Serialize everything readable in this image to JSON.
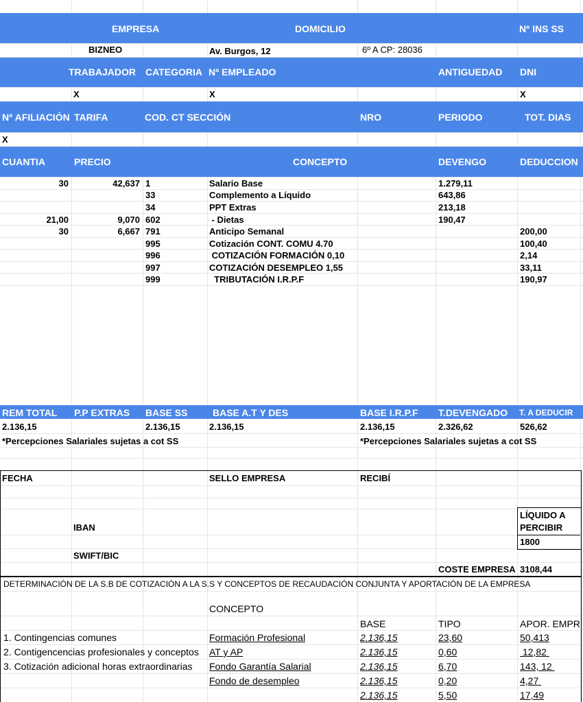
{
  "header1": {
    "empresa": "EMPRESA",
    "domicilio": "DOMICILIO",
    "ins_ss": "Nº INS SS"
  },
  "company": {
    "name": "BIZNEO",
    "address": "Av. Burgos, 12",
    "floor_cp": "6º A  CP: 28036"
  },
  "header2": {
    "trabajador": "TRABAJADOR",
    "categoria": "CATEGORIA",
    "empleado": "Nº EMPLEADO",
    "antiguedad": "ANTIGUEDAD",
    "dni": "DNI"
  },
  "row2": {
    "trabajador": "X",
    "empleado": "X",
    "dni": "X"
  },
  "header3": {
    "afiliacion": "Nº AFILIACIÓN",
    "tarifa": "TARIFA",
    "codct": "COD. CT SECCIÓN",
    "nro": "NRO",
    "periodo": "PERIODO",
    "totdias": "TOT. DIAS"
  },
  "row3": {
    "afiliacion": "X"
  },
  "header4": {
    "cuantia": "CUANTIA",
    "precio": "PRECIO",
    "concepto": "CONCEPTO",
    "devengo": "DEVENGO",
    "deduccion": "DEDUCCION"
  },
  "lines": [
    {
      "cuantia": "30",
      "precio": "42,637",
      "code": "1",
      "concepto": "Salario Base",
      "devengo": "1.279,11",
      "deduccion": ""
    },
    {
      "cuantia": "",
      "precio": "",
      "code": "33",
      "concepto": "Complemento a Líquido",
      "devengo": "643,86",
      "deduccion": ""
    },
    {
      "cuantia": "",
      "precio": "",
      "code": "34",
      "concepto": "PPT Extras",
      "devengo": "213,18",
      "deduccion": ""
    },
    {
      "cuantia": "21,00",
      "precio": "9,070",
      "code": "602",
      "concepto": " - Dietas",
      "devengo": "190,47",
      "deduccion": ""
    },
    {
      "cuantia": "30",
      "precio": "6,667",
      "code": "791",
      "concepto": "Anticipo Semanal",
      "devengo": "",
      "deduccion": "200,00"
    },
    {
      "cuantia": "",
      "precio": "",
      "code": "995",
      "concepto": "Cotización CONT. COMU 4.70",
      "devengo": "",
      "deduccion": "100,40"
    },
    {
      "cuantia": "",
      "precio": "",
      "code": "996",
      "concepto": " COTIZACIÓN FORMACIÓN 0,10",
      "devengo": "",
      "deduccion": "2,14"
    },
    {
      "cuantia": "",
      "precio": "",
      "code": "997",
      "concepto": "COTIZACIÓN DESEMPLEO 1,55",
      "devengo": "",
      "deduccion": "33,11"
    },
    {
      "cuantia": "",
      "precio": "",
      "code": "999",
      "concepto": "  TRIBUTACIÓN I.R.P.F",
      "devengo": "",
      "deduccion": "190,97"
    }
  ],
  "header5": {
    "rem_total": "REM TOTAL",
    "pp_extras": "P.P EXTRAS",
    "base_ss": "BASE SS",
    "base_at": "BASE A.T Y DES",
    "base_irpf": "BASE I.R.P.F",
    "t_devengado": "T.DEVENGADO",
    "t_deducir": "T. A DEDUCIR"
  },
  "totals": {
    "rem_total": "2.136,15",
    "base_ss": "2.136,15",
    "base_at": "2.136,15",
    "base_irpf": "2.136,15",
    "t_devengado": "2.326,62",
    "t_deducir": "526,62"
  },
  "notes": {
    "left": "*Percepciones Salariales sujetas a cot SS",
    "right": "*Percepciones Salariales sujetas a cot SS"
  },
  "signature": {
    "fecha": "FECHA",
    "sello": "SELLO EMPRESA",
    "recibi": "RECIBÍ",
    "iban": "IBAN",
    "swift": "SWIFT/BIC",
    "liquido_l1": "LÍQUIDO A",
    "liquido_l2": "PERCIBIR",
    "liquido_value": "1800",
    "coste_label": "COSTE EMPRESA",
    "coste_value": "3108,44"
  },
  "determination": {
    "title": "DETERMINACIÓN DE LA S.B DE COTIZACIÓN A LA S.S  Y CONCEPTOS DE RECAUDACIÓN CONJUNTA Y APORTACIÓN DE LA EMPRESA",
    "concepto": "CONCEPTO",
    "base": "BASE",
    "tipo": "TIPO",
    "apor": "APOR. EMPRESA",
    "rows": [
      {
        "left": "1. Contingencias comunes",
        "concepto": "Formación Profesional",
        "base": "2.136,15",
        "tipo": "23,60",
        "apor": "50,413"
      },
      {
        "left": "2. Contigencencias profesionales y conceptos",
        "concepto": "AT y AP",
        "base": "2.136,15",
        "tipo": "0,60",
        "apor": " 12,82 "
      },
      {
        "left": "3. Cotización adicional horas extraordinarias",
        "concepto": "Fondo Garantía Salarial",
        "base": "2.136,15",
        "tipo": "6,70",
        "apor": "143, 12 "
      },
      {
        "left": "",
        "concepto": "Fondo de desempleo",
        "base": "2.136,15",
        "tipo": "0,20",
        "apor": "4,27 "
      },
      {
        "left": "",
        "concepto": "",
        "base": "2.136,15",
        "tipo": "5,50",
        "apor": "17,49"
      }
    ]
  }
}
